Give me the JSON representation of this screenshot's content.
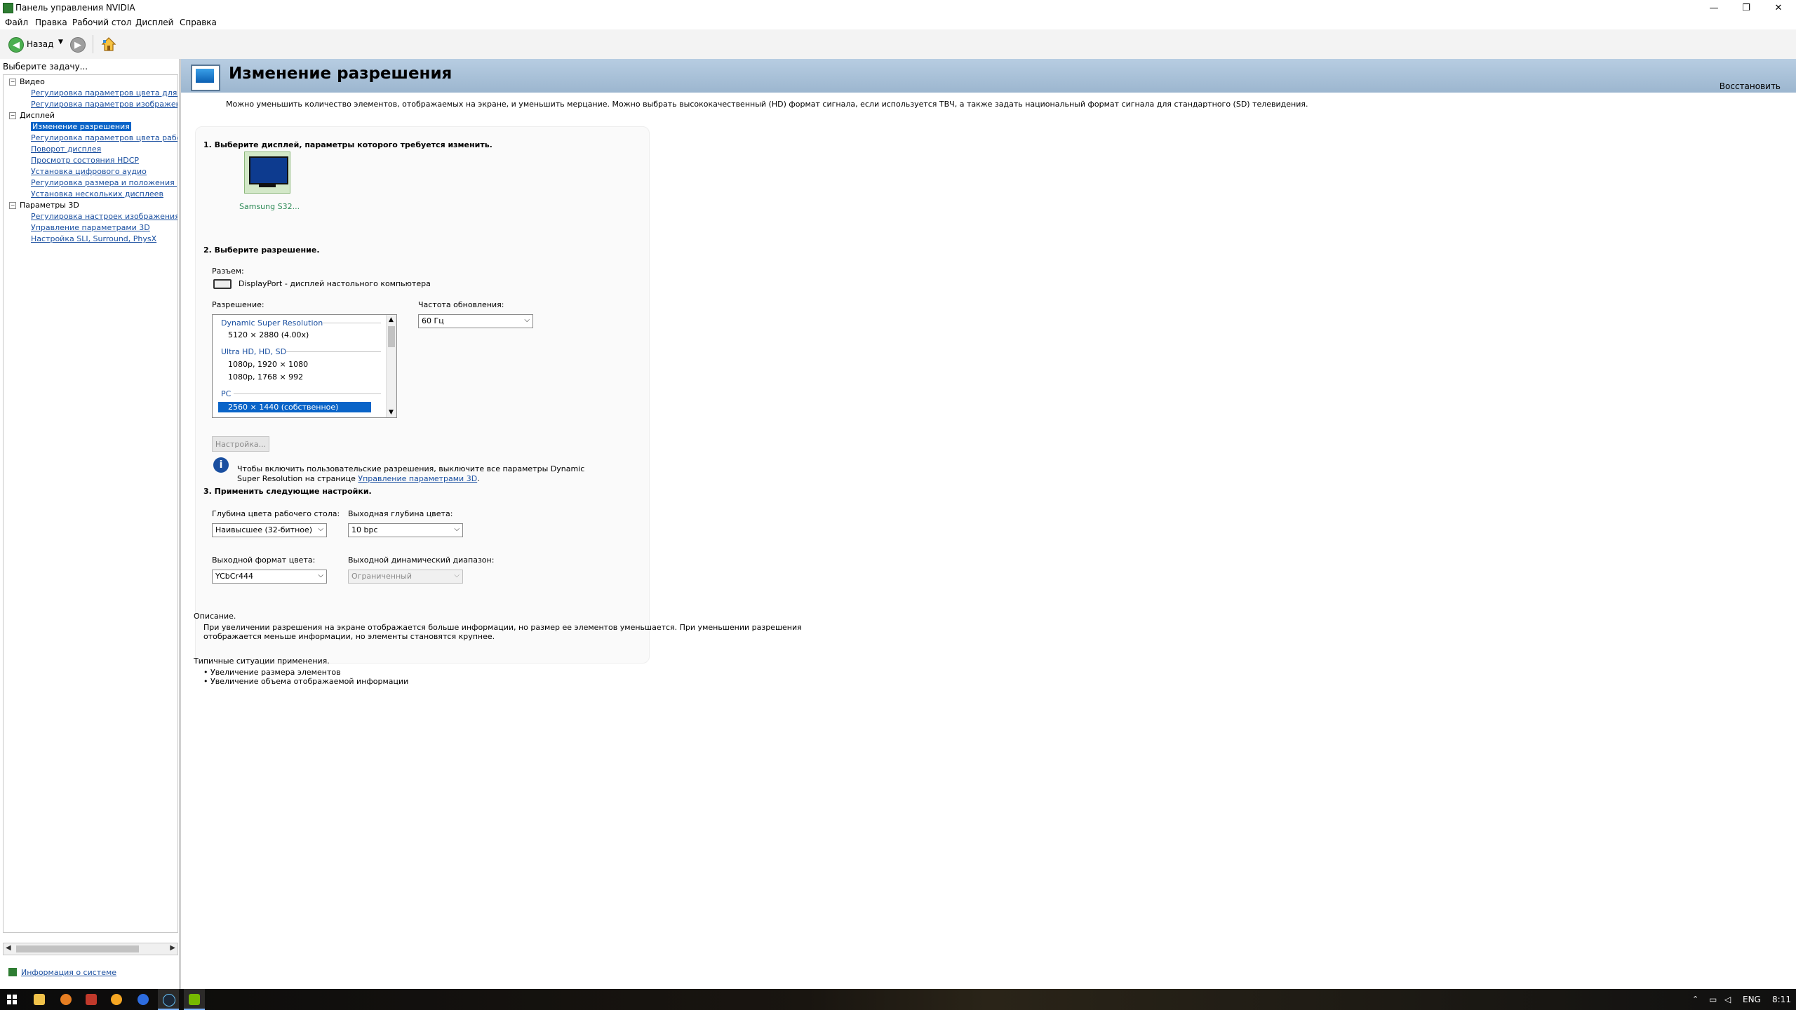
{
  "window": {
    "title": "Панель управления NVIDIA",
    "controls": {
      "minimize": "—",
      "maximize": "❐",
      "close": "✕"
    }
  },
  "menu": [
    "Файл",
    "Правка",
    "Рабочий стол",
    "Дисплей",
    "Справка"
  ],
  "toolbar": {
    "back_label": "Назад",
    "icons": [
      "back-arrow-icon",
      "forward-arrow-icon",
      "home-icon"
    ]
  },
  "sidebar": {
    "header": "Выберите задачу...",
    "tree": {
      "video": {
        "label": "Видео",
        "items": [
          "Регулировка параметров цвета для вид",
          "Регулировка параметров изображения д"
        ]
      },
      "display": {
        "label": "Дисплей",
        "items": [
          "Изменение разрешения",
          "Регулировка параметров цвета рабочег",
          "Поворот дисплея",
          "Просмотр состояния HDCP",
          "Установка цифрового аудио",
          "Регулировка размера и положения рабо",
          "Установка нескольких дисплеев"
        ]
      },
      "params3d": {
        "label": "Параметры 3D",
        "items": [
          "Регулировка настроек изображения с пр",
          "Управление параметрами 3D",
          "Настройка SLI, Surround, PhysX"
        ]
      }
    },
    "system_info": "Информация о системе"
  },
  "page": {
    "title": "Изменение разрешения",
    "restore": "Восстановить",
    "intro": "Можно уменьшить количество элементов, отображаемых на экране, и уменьшить мерцание. Можно выбрать высококачественный (HD) формат сигнала, если используется ТВЧ, а также задать национальный формат сигнала для стандартного (SD) телевидения.",
    "step1": "1. Выберите дисплей, параметры которого требуется изменить.",
    "display_name": "Samsung S32...",
    "step2": "2. Выберите разрешение.",
    "connector_label": "Разъем:",
    "connector_value": "DisplayPort - дисплей настольного компьютера",
    "resolution_label": "Разрешение:",
    "refresh_label": "Частота обновления:",
    "refresh_value": "60 Гц",
    "resolution_list": {
      "group_dsr": "Dynamic Super Resolution",
      "dsr_1": "5120 × 2880 (4.00x)",
      "group_uhd": "Ultra HD, HD, SD",
      "uhd_1": "1080p, 1920 × 1080",
      "uhd_2": "1080p, 1768 × 992",
      "group_pc": "PC",
      "pc_selected": "2560 × 1440 (собственное)"
    },
    "customize_button": "Настройка...",
    "info_line1": "Чтобы включить пользовательские разрешения, выключите все параметры Dynamic",
    "info_line2_pre": "Super Resolution на странице ",
    "info_link": "Управление параметрами 3D",
    "info_line2_post": ".",
    "step3": "3. Применить следующие настройки.",
    "desktop_depth_label": "Глубина цвета рабочего стола:",
    "desktop_depth_value": "Наивысшее (32-битное)",
    "output_depth_label": "Выходная глубина цвета:",
    "output_depth_value": "10 bpc",
    "output_format_label": "Выходной формат цвета:",
    "output_format_value": "YCbCr444",
    "dynamic_range_label": "Выходной динамический диапазон:",
    "dynamic_range_value": "Ограниченный",
    "description_title": "Описание.",
    "description_line1": "При увеличении разрешения на экране отображается больше информации, но размер ее элементов уменьшается. При уменьшении разрешения",
    "description_line2": "отображается меньше информации, но элементы становятся крупнее.",
    "typical_title": "Типичные ситуации применения.",
    "typical_1": "• Увеличение размера элементов",
    "typical_2": "• Увеличение объема отображаемой информации"
  },
  "taskbar": {
    "lang": "ENG",
    "time": "8:11",
    "icons": [
      "windows-start-icon",
      "file-explorer-icon",
      "app-icon-1",
      "app-icon-2",
      "app-icon-3",
      "app-icon-4",
      "steam-icon",
      "nvidia-icon"
    ]
  },
  "colors": {
    "accent": "#0a64c8",
    "link": "#1a4fa0",
    "banner": "#9cb6cf",
    "nvidia_green": "#2e7d32"
  }
}
